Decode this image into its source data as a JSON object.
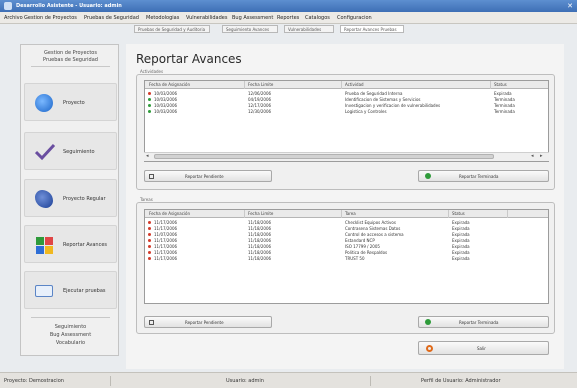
{
  "window": {
    "title": "Desarrollo Asistente - Usuario: admin"
  },
  "menu": [
    "Archivo",
    "Gestion de Proyectos",
    "Pruebas de Seguridad",
    "Metodologias",
    "Vulnerabilidades",
    "Bug Assessment",
    "Reportes",
    "Catalogos",
    "Configuracion"
  ],
  "subtabs": [
    "Pruebas de Seguridad y Auditoria",
    "Seguimiento Avances",
    "Vulnerabilidades",
    "Reportar Avances Pruebas"
  ],
  "sidebar": {
    "title_lines": [
      "Gestion de Proyectos",
      "Pruebas de Seguridad"
    ],
    "items": [
      {
        "label": "Proyecto",
        "icon": "project-icon"
      },
      {
        "label": "Seguimiento",
        "icon": "checkmark-icon"
      },
      {
        "label": "Proyecto Regular",
        "icon": "bird-icon"
      },
      {
        "label": "Reportar Avances",
        "icon": "puzzle-icon"
      },
      {
        "label": "Ejecutar pruebas",
        "icon": "monitor-icon"
      }
    ],
    "footer_lines": [
      "Seguimiento",
      "Bug Assessment",
      "Vocabulario"
    ]
  },
  "page": {
    "heading": "Reportar Avances"
  },
  "activities": {
    "group_label": "Actividades",
    "columns": [
      "Fecha de Asignación",
      "Fecha Limite",
      "Actividad",
      "Status"
    ],
    "rows": [
      {
        "status_icon": "error",
        "asignacion": "10/03/2006",
        "limite": "12/06/2006",
        "actividad": "Prueba de Seguridad Interna",
        "status": "Expirada"
      },
      {
        "status_icon": "ok",
        "asignacion": "10/03/2006",
        "limite": "04/19/2006",
        "actividad": "Identificacion de Sistemas y Servicios",
        "status": "Terminada"
      },
      {
        "status_icon": "ok",
        "asignacion": "10/03/2006",
        "limite": "12/17/2006",
        "actividad": "Investigacion y verificacion de vulnerabilidades",
        "status": "Terminada"
      },
      {
        "status_icon": "ok",
        "asignacion": "10/03/2006",
        "limite": "12/30/2006",
        "actividad": "Logistica y Controles",
        "status": "Terminada"
      }
    ],
    "btn_pending": "Reportar Pendiente",
    "btn_done": "Reportar Terminada"
  },
  "tasks": {
    "group_label": "Tareas",
    "columns": [
      "Fecha de Asignación",
      "Fecha Limite",
      "Tarea",
      "Status"
    ],
    "rows": [
      {
        "asignacion": "11/17/2006",
        "limite": "11/18/2006",
        "tarea": "Checklist Equipos Activos",
        "status": "Expirada"
      },
      {
        "asignacion": "11/17/2006",
        "limite": "11/18/2006",
        "tarea": "Contrasena Sistemas Datos",
        "status": "Expirada"
      },
      {
        "asignacion": "11/07/2006",
        "limite": "11/18/2006",
        "tarea": "Control de accesos a sistema",
        "status": "Expirada"
      },
      {
        "asignacion": "11/17/2006",
        "limite": "11/18/2006",
        "tarea": "Estandard NCP",
        "status": "Expirada"
      },
      {
        "asignacion": "11/17/2006",
        "limite": "11/18/2006",
        "tarea": "ISO 17799 / 2005",
        "status": "Expirada"
      },
      {
        "asignacion": "11/17/2006",
        "limite": "11/18/2006",
        "tarea": "Politica de Respaldos",
        "status": "Expirada"
      },
      {
        "asignacion": "11/17/2006",
        "limite": "11/18/2006",
        "tarea": "TRUST 50",
        "status": "Expirada"
      }
    ],
    "btn_pending": "Reportar Pendiente",
    "btn_done": "Reportar Terminada"
  },
  "btn_exit": "Salir",
  "statusbar": {
    "project": "Proyecto: Demostracion",
    "user": "Usuario: admin",
    "profile": "Perfil de Usuario: Administrador"
  },
  "colors": {
    "ok": "#2e9b3a",
    "error": "#d23a2a",
    "title": "#3e6fb5"
  }
}
